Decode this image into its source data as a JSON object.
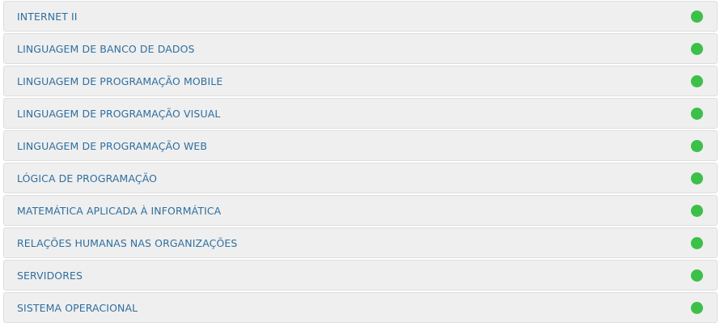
{
  "status_color": "#3cc04a",
  "text_color": "#2f6fa0",
  "courses": [
    {
      "name": "INTERNET II",
      "status": "green-dot-icon"
    },
    {
      "name": "LINGUAGEM DE BANCO DE DADOS",
      "status": "green-dot-icon"
    },
    {
      "name": "LINGUAGEM DE PROGRAMAÇÃO MOBILE",
      "status": "green-dot-icon"
    },
    {
      "name": "LINGUAGEM DE PROGRAMAÇÃO VISUAL",
      "status": "green-dot-icon"
    },
    {
      "name": "LINGUAGEM DE PROGRAMAÇÃO WEB",
      "status": "green-dot-icon"
    },
    {
      "name": "LÓGICA DE PROGRAMAÇÃO",
      "status": "green-dot-icon"
    },
    {
      "name": "MATEMÁTICA APLICADA À INFORMÁTICA",
      "status": "green-dot-icon"
    },
    {
      "name": "RELAÇÕES HUMANAS NAS ORGANIZAÇÕES",
      "status": "green-dot-icon"
    },
    {
      "name": "SERVIDORES",
      "status": "green-dot-icon"
    },
    {
      "name": "SISTEMA OPERACIONAL",
      "status": "green-dot-icon"
    }
  ]
}
